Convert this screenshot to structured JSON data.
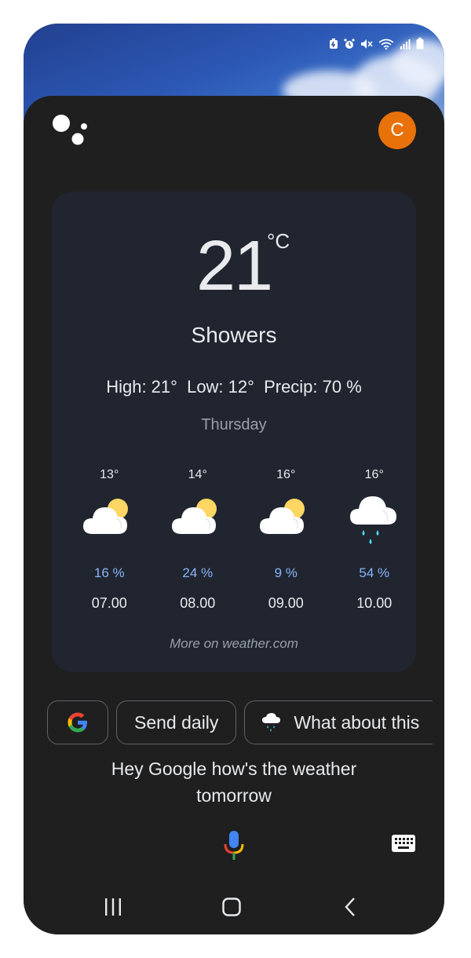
{
  "status_bar": {
    "icons": [
      "battery-saver-icon",
      "alarm-icon",
      "mute-icon",
      "wifi-icon",
      "signal-icon",
      "battery-icon"
    ]
  },
  "assistant": {
    "avatar_letter": "C",
    "avatar_color": "#e8710a"
  },
  "weather": {
    "temperature": "21",
    "unit": "°C",
    "condition": "Showers",
    "high": "High: 21°",
    "low": "Low: 12°",
    "precip": "Precip: 70 %",
    "day": "Thursday",
    "hourly": [
      {
        "temp": "13°",
        "icon": "partly-sunny-icon",
        "precip": "16 %",
        "time": "07.00"
      },
      {
        "temp": "14°",
        "icon": "partly-sunny-icon",
        "precip": "24 %",
        "time": "08.00"
      },
      {
        "temp": "16°",
        "icon": "partly-sunny-icon",
        "precip": "9 %",
        "time": "09.00"
      },
      {
        "temp": "16°",
        "icon": "rain-cloud-icon",
        "precip": "54 %",
        "time": "10.00"
      }
    ],
    "more_link": "More on weather.com"
  },
  "chips": {
    "google": "google-logo-icon",
    "send_daily": "Send daily",
    "what_about": "What about this"
  },
  "query": {
    "line1": "Hey Google how's the weather",
    "line2": "tomorrow"
  },
  "colors": {
    "card_bg": "#202530",
    "sheet_bg": "#1f1f1f",
    "precip_blue": "#8ab4f8",
    "accent_orange": "#e8710a"
  }
}
